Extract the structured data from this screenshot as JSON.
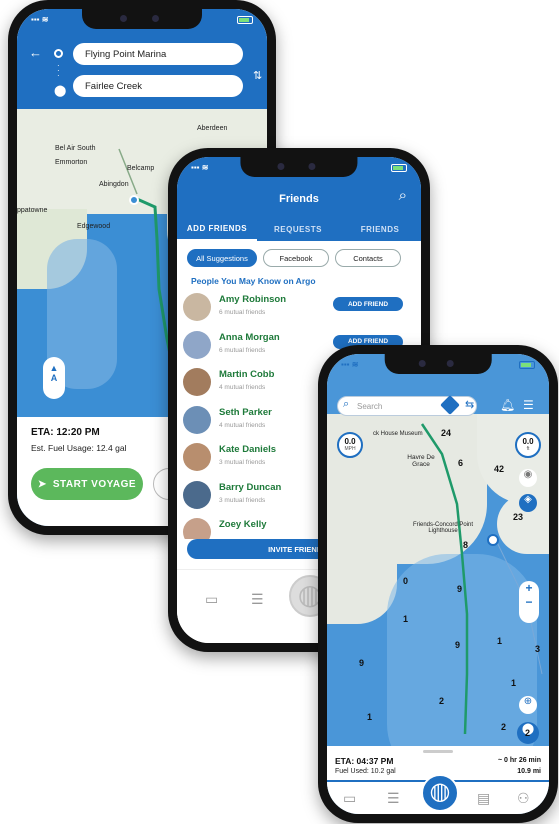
{
  "phone1": {
    "origin": "Flying Point Marina",
    "destination": "Fairlee Creek",
    "places": [
      "Aberdeen",
      "Bel Air South",
      "Emmorton",
      "Belcamp",
      "Abingdon",
      "Edgewood",
      "ppatowne"
    ],
    "eta": "ETA: 12:20 PM",
    "fuel": "Est. Fuel Usage: 12.4 gal",
    "start_button": "START VOYAGE",
    "map_badge": "A"
  },
  "phone2": {
    "title": "Friends",
    "tabs": [
      "ADD FRIENDS",
      "REQUESTS",
      "FRIENDS"
    ],
    "chips": [
      "All Suggestions",
      "Facebook",
      "Contacts"
    ],
    "section_title": "People You May Know on Argo",
    "people": [
      {
        "name": "Amy Robinson",
        "mutual": "6 mutual friends",
        "action": "ADD FRIEND"
      },
      {
        "name": "Anna Morgan",
        "mutual": "6 mutual friends",
        "action": "ADD FRIEND"
      },
      {
        "name": "Martin Cobb",
        "mutual": "4 mutual friends",
        "action": ""
      },
      {
        "name": "Seth Parker",
        "mutual": "4 mutual friends",
        "action": ""
      },
      {
        "name": "Kate Daniels",
        "mutual": "3 mutual friends",
        "action": ""
      },
      {
        "name": "Barry Duncan",
        "mutual": "3 mutual friends",
        "action": ""
      },
      {
        "name": "Zoey Kelly",
        "mutual": "",
        "action": ""
      }
    ],
    "invite_button": "INVITE FRIENDS TO J"
  },
  "phone3": {
    "search_placeholder": "Search",
    "speed_value": "0.0",
    "speed_unit": "MPH",
    "heading_value": "0.0",
    "heading_unit": "ft",
    "places": [
      "Havre De Grace",
      "Friends-Concord Point Lighthouse",
      "ck House Museum"
    ],
    "depths": [
      "24",
      "6",
      "42",
      "23",
      "8",
      "0",
      "9",
      "1",
      "9",
      "1",
      "3",
      "9",
      "1",
      "2",
      "1",
      "2",
      "2"
    ],
    "eta": "ETA: 04:37 PM",
    "fuel": "Fuel Used: 10.2 gal",
    "duration": "~ 0 hr 26 min",
    "distance": "10.9 mi"
  },
  "colors": {
    "water": "#3b8ed4",
    "nav_blue": "#1f6fc1",
    "route_green": "#1f9a6a",
    "friend_name": "#1e7a3a",
    "button_green": "#5cb85c"
  }
}
